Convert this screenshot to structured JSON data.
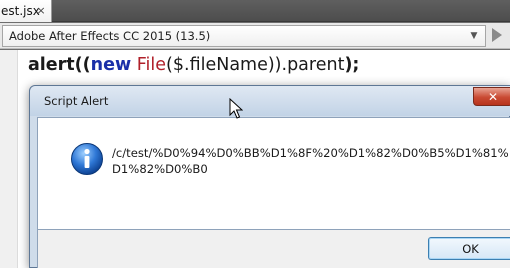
{
  "tab": {
    "label": "est.jsx",
    "close_glyph": "×"
  },
  "target": {
    "value": "Adobe After Effects CC 2015 (13.5)",
    "chevron_icon": "chevron-down-icon",
    "run_icon": "play-icon"
  },
  "editor": {
    "code": {
      "t1": "alert((",
      "kw_new": "new",
      "t2": " ",
      "cls_file": "File",
      "t3": "($.fileName)).parent",
      "t4": ");"
    }
  },
  "dialog": {
    "title": "Script Alert",
    "close_glyph": "✕",
    "icon": "info-icon",
    "message": "/c/test/%D0%94%D0%BB%D1%8F%20%D1%82%D0%B5%D1%81%D1%82%D0%B0",
    "ok_label": "OK"
  },
  "colors": {
    "keyword": "#1a2fa8",
    "class_name": "#b0202a",
    "close_button": "#c94a33",
    "dialog_frame": "#cfdcea"
  }
}
